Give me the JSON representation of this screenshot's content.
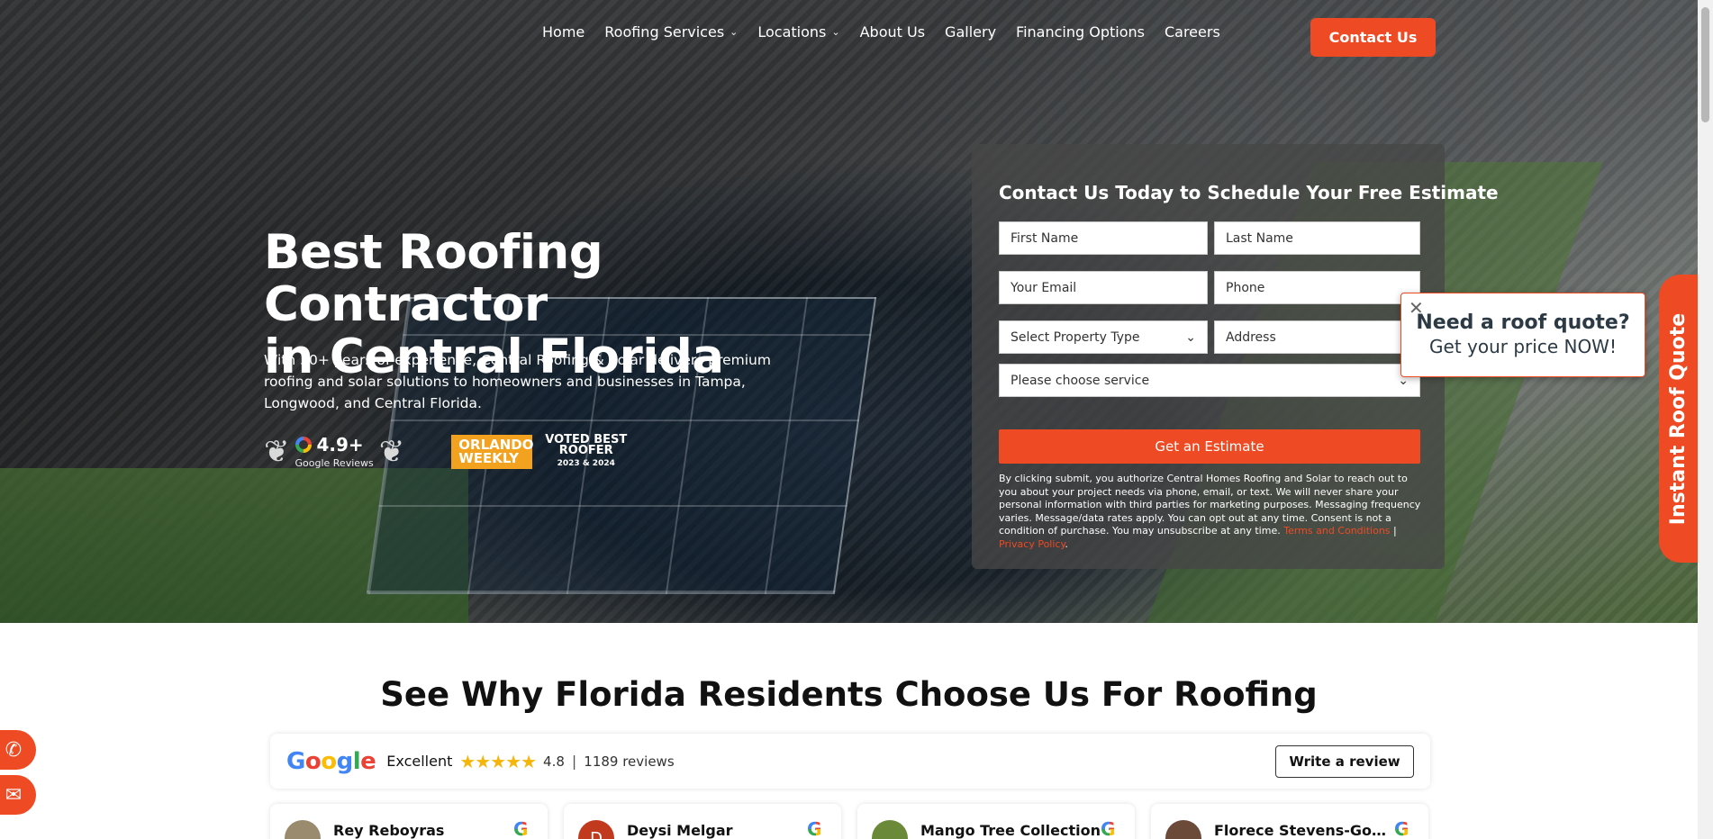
{
  "nav": {
    "items": [
      {
        "label": "Home",
        "dropdown": false
      },
      {
        "label": "Roofing Services",
        "dropdown": true
      },
      {
        "label": "Locations",
        "dropdown": true
      },
      {
        "label": "About Us",
        "dropdown": false
      },
      {
        "label": "Gallery",
        "dropdown": false
      },
      {
        "label": "Financing Options",
        "dropdown": false
      },
      {
        "label": "Careers",
        "dropdown": false
      }
    ],
    "contact_label": "Contact Us"
  },
  "hero": {
    "title_line1": "Best Roofing Contractor",
    "title_line2": "in Central Florida",
    "subtitle": "With 30+ years of experience, Central Roofing & Solar delivers premium roofing and solar solutions to homeowners and businesses in Tampa, Longwood, and Central Florida.",
    "google_rating": "4.9+",
    "google_label": "Google Reviews",
    "ow_line1": "ORLANDO",
    "ow_line2": "WEEKLY",
    "voted_line1": "VOTED BEST",
    "voted_line2": "ROOFER",
    "voted_years": "2023 & 2024"
  },
  "form": {
    "title": "Contact Us Today to Schedule Your Free Estimate",
    "first_name": "First Name",
    "last_name": "Last Name",
    "email": "Your Email",
    "phone": "Phone",
    "property_type": "Select Property Type",
    "address": "Address",
    "service": "Please choose service",
    "submit": "Get an Estimate",
    "disclaimer": "By clicking submit, you authorize Central Homes Roofing and Solar to reach out to you about your project needs via phone, email, or text. We will never share your personal information with third parties for marketing purposes. Messaging frequency varies. Message/data rates apply. You can opt out at any time. Consent is not a condition of purchase. You may unsubscribe at any time.",
    "terms_link": "Terms and Conditions",
    "divider": "|",
    "privacy_link": "Privacy Policy",
    "period": "."
  },
  "quote_popup": {
    "line1": "Need a roof quote?",
    "line2": "Get your price NOW!",
    "close": "✕",
    "tab_label": "Instant Roof Quote"
  },
  "reviews": {
    "section_title": "See Why Florida Residents Choose Us For Roofing",
    "google_word": [
      "G",
      "o",
      "o",
      "g",
      "l",
      "e"
    ],
    "excellent": "Excellent",
    "stars": "★★★★★",
    "score": "4.8",
    "sep": "|",
    "count": "1189 reviews",
    "write_label": "Write a review",
    "cards": [
      {
        "name": "Rey Reboyras",
        "initial": ""
      },
      {
        "name": "Deysi Melgar",
        "initial": "D"
      },
      {
        "name": "Mango Tree Collection",
        "initial": ""
      },
      {
        "name": "Florece Stevens-Gonzal...",
        "initial": ""
      }
    ]
  },
  "colors": {
    "accent": "#ee4a23",
    "dark_text": "#2c3a45"
  },
  "icons": {
    "phone": "phone-icon",
    "mail": "mail-icon",
    "google": "google-icon",
    "chevron": "chevron-down-icon"
  }
}
